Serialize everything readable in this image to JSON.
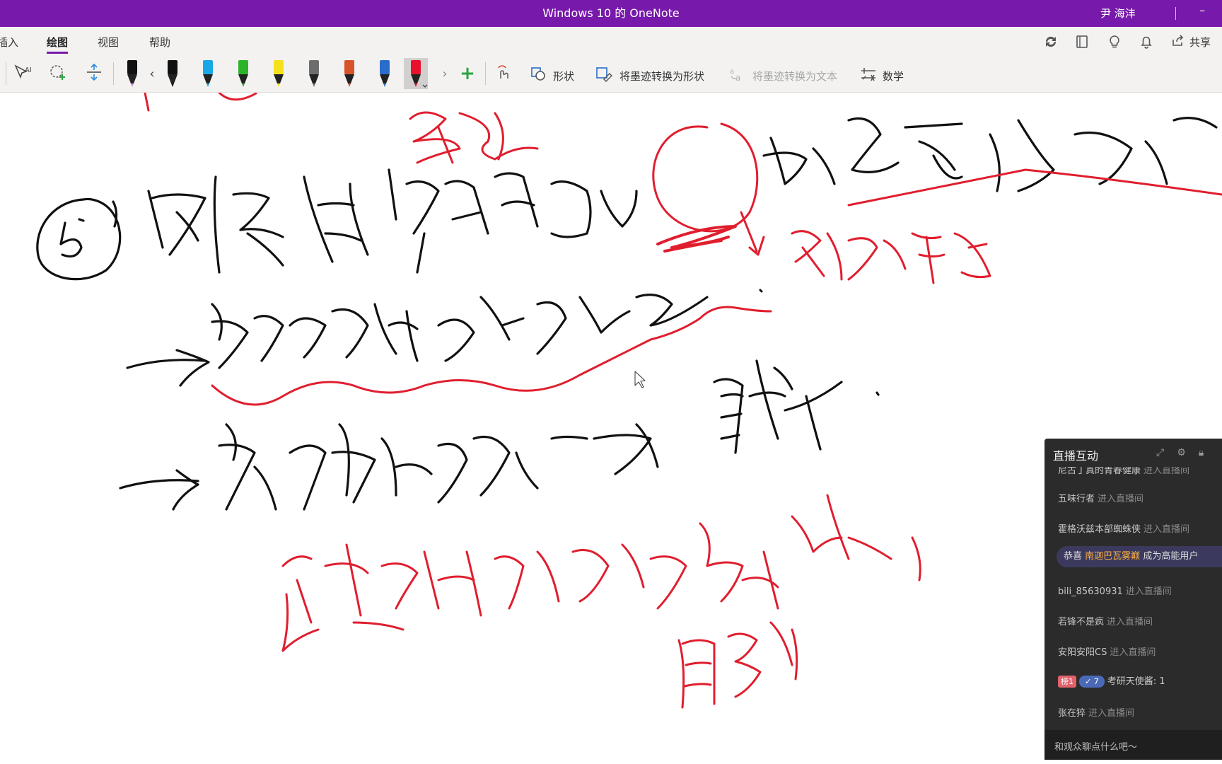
{
  "window": {
    "title": "Windows 10 的 OneNote",
    "user": "尹 海沣",
    "minimize": "–"
  },
  "tabs": [
    {
      "label": "插入",
      "active": false
    },
    {
      "label": "绘图",
      "active": true
    },
    {
      "label": "视图",
      "active": false
    },
    {
      "label": "帮助",
      "active": false
    }
  ],
  "top_icons": [
    "sync-icon",
    "notebook-icon",
    "lightbulb-icon",
    "bell-icon"
  ],
  "share_label": "共享",
  "toolbar": {
    "shapes_label": "形状",
    "ink_to_shape_label": "将墨迹转换为形状",
    "ink_to_text_label": "将墨迹转换为文本",
    "math_label": "数学",
    "pens": [
      {
        "name": "black-marker-pen",
        "color": "#111111",
        "tip": "#c78ad6"
      },
      {
        "name": "black-pen",
        "color": "#111111"
      },
      {
        "name": "blue-pen",
        "color": "#1aa7e5"
      },
      {
        "name": "green-pen",
        "color": "#2bb42b"
      },
      {
        "name": "yellow-highlighter",
        "color": "#f5e11b"
      },
      {
        "name": "galaxy-pen",
        "color": "#6d6d6d"
      },
      {
        "name": "rainbow-pen",
        "color": "#d9532a"
      },
      {
        "name": "ocean-pen",
        "color": "#2a6cc9"
      },
      {
        "name": "red-pen",
        "color": "#e8102b",
        "selected": true
      }
    ]
  },
  "ink_colors": {
    "black": "#111111",
    "red": "#e01e2e"
  },
  "live_panel": {
    "title": "直播互动",
    "messages": [
      {
        "name": "尼古丁真的青春健康",
        "action": "进入直播间"
      },
      {
        "name": "五味行者",
        "action": "进入直播间"
      },
      {
        "name": "霍格沃兹本部蜘蛛侠",
        "action": "进入直播间"
      },
      {
        "notice_prefix": "恭喜",
        "notice_name": "南迦巴瓦雾巅",
        "notice_suffix": "成为高能用户"
      },
      {
        "name": "bili_85630931",
        "action": "进入直播间"
      },
      {
        "name": "若锋不是疯",
        "action": "进入直播间"
      },
      {
        "name": "安阳安阳CS",
        "action": "进入直播间"
      },
      {
        "badge_rank": "榜1",
        "badge_level": "✓ 7",
        "name": "考研天使酱",
        "action": ": 1"
      },
      {
        "name": "张在猝",
        "action": "进入直播间"
      }
    ],
    "input_placeholder": "和观众聊点什么吧～"
  }
}
